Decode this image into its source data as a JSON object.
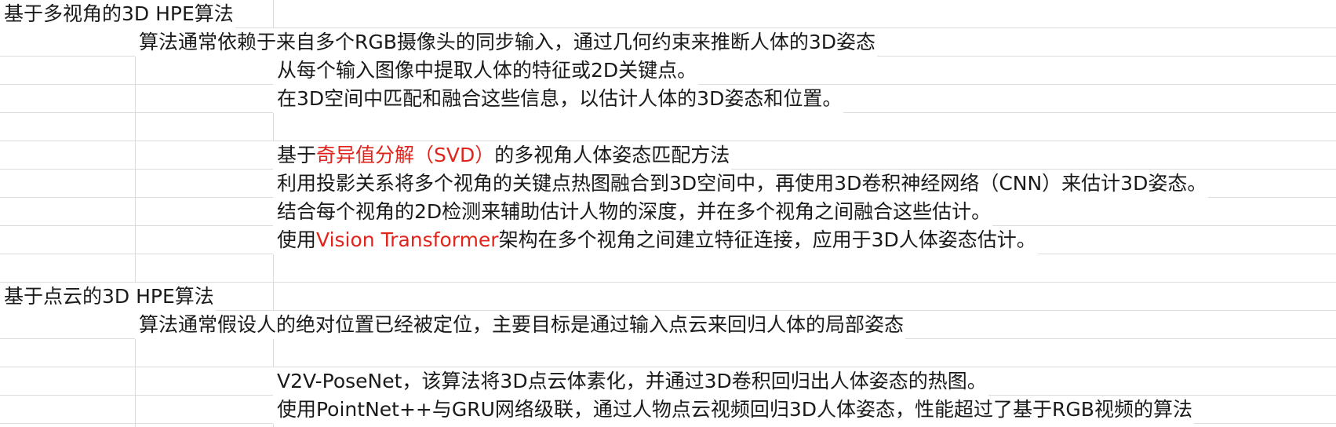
{
  "rows": [
    {
      "text": "基于多视角的3D HPE算法"
    },
    {
      "text": "算法通常依赖于来自多个RGB摄像头的同步输入，通过几何约束来推断人体的3D姿态"
    },
    {
      "text": "从每个输入图像中提取人体的特征或2D关键点。"
    },
    {
      "text": "在3D空间中匹配和融合这些信息，以估计人体的3D姿态和位置。"
    },
    {
      "text": ""
    },
    {
      "before": "基于",
      "highlight": "奇异值分解（SVD）",
      "after": "的多视角人体姿态匹配方法"
    },
    {
      "text": "利用投影关系将多个视角的关键点热图融合到3D空间中，再使用3D卷积神经网络（CNN）来估计3D姿态。"
    },
    {
      "text": "结合每个视角的2D检测来辅助估计人物的深度，并在多个视角之间融合这些估计。"
    },
    {
      "before": "使用",
      "highlight": "Vision Transformer",
      "after": "架构在多个视角之间建立特征连接，应用于3D人体姿态估计。"
    },
    {
      "text": ""
    },
    {
      "text": "基于点云的3D HPE算法"
    },
    {
      "text": "算法通常假设人的绝对位置已经被定位，主要目标是通过输入点云来回归人体的局部姿态"
    },
    {
      "text": ""
    },
    {
      "text": "V2V-PoseNet，该算法将3D点云体素化，并通过3D卷积回归出人体姿态的热图。"
    },
    {
      "text": "使用PointNet++与GRU网络级联，通过人物点云视频回归3D人体姿态，性能超过了基于RGB视频的算法"
    }
  ],
  "colors": {
    "text": "#1a1a1a",
    "highlight": "#e0241b",
    "gridline": "#dcdcdc",
    "background": "#ffffff"
  }
}
